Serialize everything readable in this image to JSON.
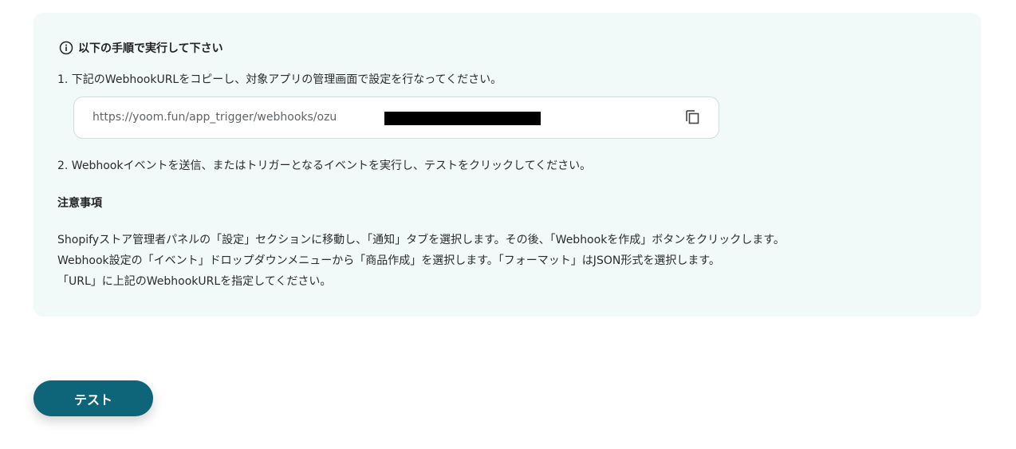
{
  "instructions": {
    "heading": "以下の手順で実行して下さい",
    "heading_icon": "info-icon",
    "step1": "1. 下記のWebhookURLをコピーし、対象アプリの管理画面で設定を行なってください。",
    "webhook_url": "https://yoom.fun/app_trigger/webhooks/ozu",
    "copy_icon": "copy-icon",
    "step2": "2. Webhookイベントを送信、またはトリガーとなるイベントを実行し、テストをクリックしてください。"
  },
  "notes": {
    "title": "注意事項",
    "lines": [
      "Shopifyストア管理者パネルの「設定」セクションに移動し、「通知」タブを選択します。その後、「Webhookを作成」ボタンをクリックします。",
      "Webhook設定の「イベント」ドロップダウンメニューから「商品作成」を選択します。「フォーマット」はJSON形式を選択します。",
      "「URL」に上記のWebhookURLを指定してください。"
    ]
  },
  "actions": {
    "test_label": "テスト"
  },
  "colors": {
    "panel_bg": "#f1f9f9",
    "button_bg": "#0e6478",
    "button_text": "#ffffff"
  }
}
